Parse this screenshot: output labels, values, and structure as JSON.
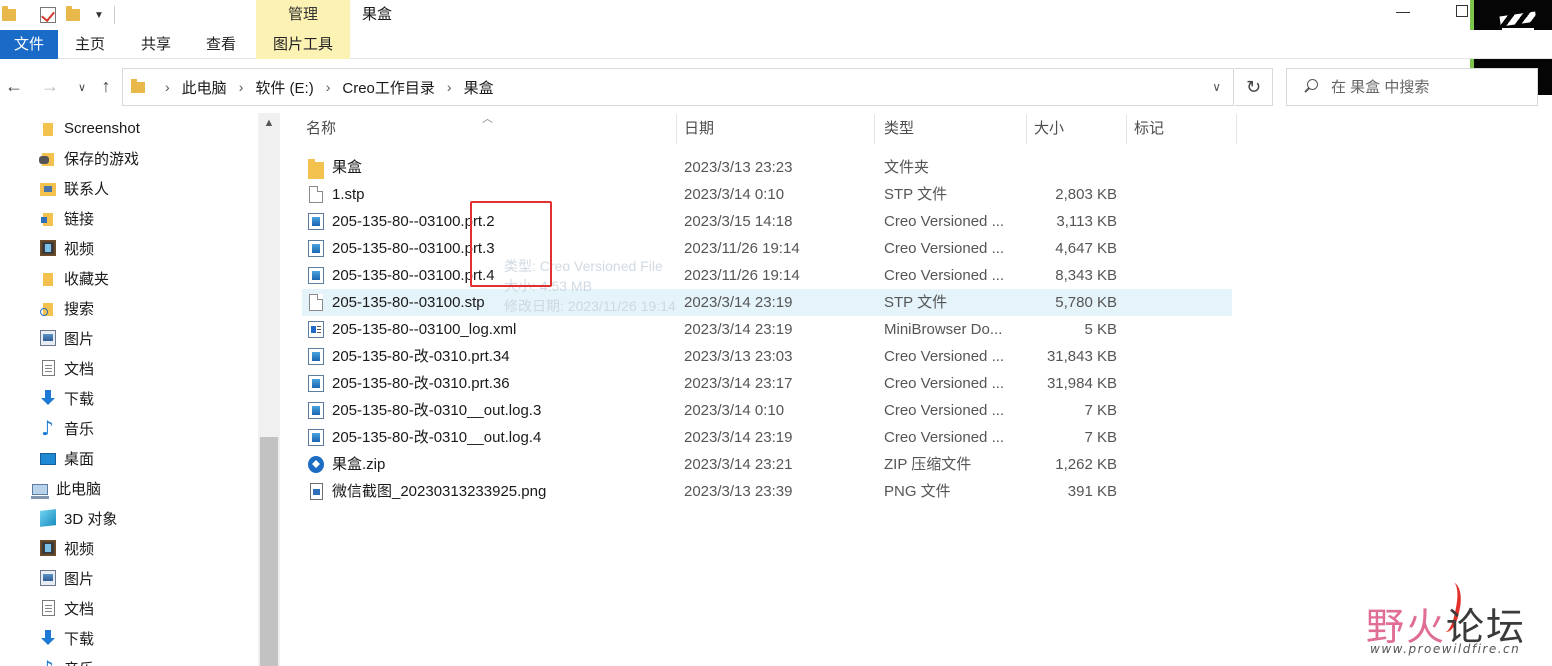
{
  "title_bar": {
    "manage_label": "管理",
    "window_title": "果盒"
  },
  "ribbon": {
    "tabs": [
      {
        "label": "文件"
      },
      {
        "label": "主页"
      },
      {
        "label": "共享"
      },
      {
        "label": "查看"
      },
      {
        "label": "图片工具"
      }
    ]
  },
  "address": {
    "crumbs": [
      "此电脑",
      "软件 (E:)",
      "Creo工作目录",
      "果盒"
    ],
    "search_placeholder": "在 果盒 中搜索"
  },
  "sidebar": {
    "items": [
      {
        "label": "Screenshot",
        "icon": "folder-icon"
      },
      {
        "label": "保存的游戏",
        "icon": "saved-games-icon"
      },
      {
        "label": "联系人",
        "icon": "contacts-icon"
      },
      {
        "label": "链接",
        "icon": "links-icon"
      },
      {
        "label": "视频",
        "icon": "video-icon"
      },
      {
        "label": "收藏夹",
        "icon": "favorites-icon"
      },
      {
        "label": "搜索",
        "icon": "searches-icon"
      },
      {
        "label": "图片",
        "icon": "pictures-icon"
      },
      {
        "label": "文档",
        "icon": "documents-icon"
      },
      {
        "label": "下载",
        "icon": "downloads-icon"
      },
      {
        "label": "音乐",
        "icon": "music-icon"
      },
      {
        "label": "桌面",
        "icon": "desktop-icon"
      },
      {
        "label": "此电脑",
        "icon": "this-pc-icon"
      },
      {
        "label": "3D 对象",
        "icon": "3d-objects-icon"
      },
      {
        "label": "视频",
        "icon": "video-icon"
      },
      {
        "label": "图片",
        "icon": "pictures-icon"
      },
      {
        "label": "文档",
        "icon": "documents-icon"
      },
      {
        "label": "下载",
        "icon": "downloads-icon"
      },
      {
        "label": "音乐",
        "icon": "music-icon"
      }
    ]
  },
  "columns": {
    "name": "名称",
    "date": "日期",
    "type": "类型",
    "size": "大小",
    "tags": "标记"
  },
  "files": [
    {
      "name": "果盒",
      "date": "2023/3/13 23:23",
      "type": "文件夹",
      "size": "",
      "icon": "folder-icon"
    },
    {
      "name": "1.stp",
      "date": "2023/3/14 0:10",
      "type": "STP 文件",
      "size": "2,803 KB",
      "icon": "stp-file-icon"
    },
    {
      "name": "205-135-80--03100.prt.2",
      "date": "2023/3/15 14:18",
      "type": "Creo Versioned ...",
      "size": "3,113 KB",
      "icon": "creo-file-icon"
    },
    {
      "name": "205-135-80--03100.prt.3",
      "date": "2023/11/26 19:14",
      "type": "Creo Versioned ...",
      "size": "4,647 KB",
      "icon": "creo-file-icon"
    },
    {
      "name": "205-135-80--03100.prt.4",
      "date": "2023/11/26 19:14",
      "type": "Creo Versioned ...",
      "size": "8,343 KB",
      "icon": "creo-file-icon"
    },
    {
      "name": "205-135-80--03100.stp",
      "date": "2023/3/14 23:19",
      "type": "STP 文件",
      "size": "5,780 KB",
      "icon": "stp-file-icon"
    },
    {
      "name": "205-135-80--03100_log.xml",
      "date": "2023/3/14 23:19",
      "type": "MiniBrowser Do...",
      "size": "5 KB",
      "icon": "xml-file-icon"
    },
    {
      "name": "205-135-80-改-0310.prt.34",
      "date": "2023/3/13 23:03",
      "type": "Creo Versioned ...",
      "size": "31,843 KB",
      "icon": "creo-file-icon"
    },
    {
      "name": "205-135-80-改-0310.prt.36",
      "date": "2023/3/14 23:17",
      "type": "Creo Versioned ...",
      "size": "31,984 KB",
      "icon": "creo-file-icon"
    },
    {
      "name": "205-135-80-改-0310__out.log.3",
      "date": "2023/3/14 0:10",
      "type": "Creo Versioned ...",
      "size": "7 KB",
      "icon": "creo-file-icon"
    },
    {
      "name": "205-135-80-改-0310__out.log.4",
      "date": "2023/3/14 23:19",
      "type": "Creo Versioned ...",
      "size": "7 KB",
      "icon": "creo-file-icon"
    },
    {
      "name": "果盒.zip",
      "date": "2023/3/14 23:21",
      "type": "ZIP 压缩文件",
      "size": "1,262 KB",
      "icon": "zip-file-icon"
    },
    {
      "name": "微信截图_20230313233925.png",
      "date": "2023/3/13 23:39",
      "type": "PNG 文件",
      "size": "391 KB",
      "icon": "png-file-icon"
    }
  ],
  "tooltip_ghost": {
    "line1": "类型: Creo Versioned File",
    "line2": "大小: 4.53 MB",
    "line3": "修改日期: 2023/11/26 19:14"
  },
  "watermark": {
    "text_part1": "野火",
    "text_part2": "论坛",
    "url": "www.proewildfire.cn"
  },
  "colors": {
    "file_tab": "#1a6ac7",
    "contextual_tab": "#fbf2b4",
    "selection": "#e5f3fb",
    "highlight_box": "#e0302f"
  }
}
